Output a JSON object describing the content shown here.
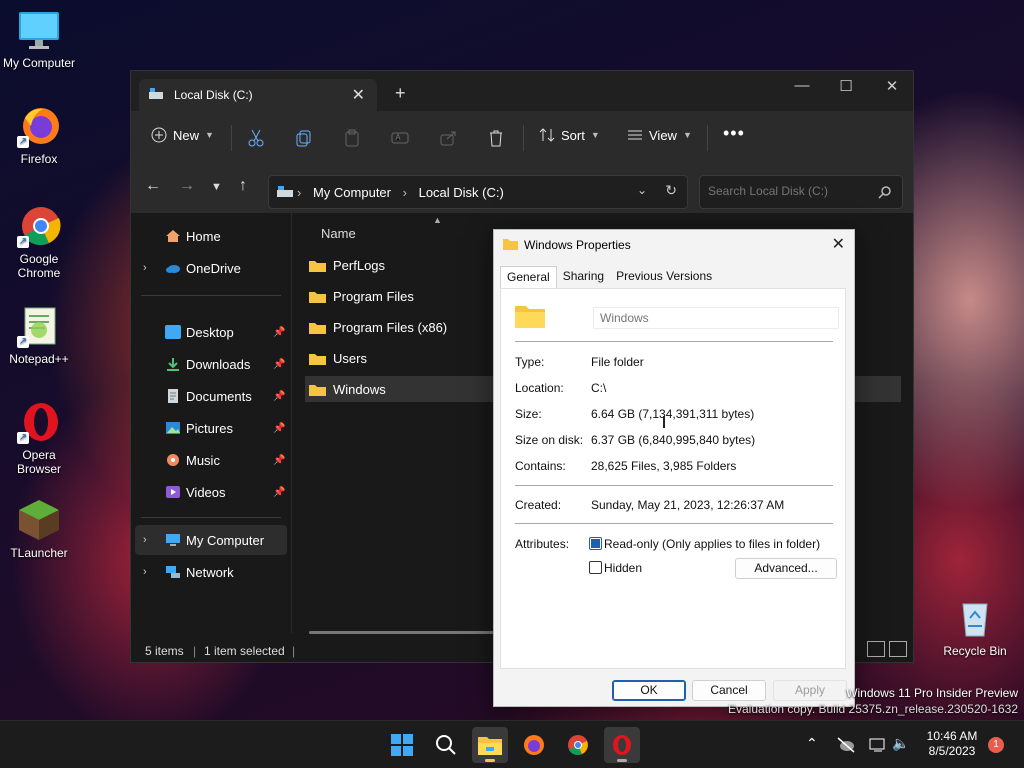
{
  "desktop": {
    "icons": [
      {
        "label": "My Computer"
      },
      {
        "label": "Firefox"
      },
      {
        "label": "Google Chrome"
      },
      {
        "label": "Notepad++"
      },
      {
        "label": "Opera Browser"
      },
      {
        "label": "TLauncher"
      },
      {
        "label": "Recycle Bin"
      }
    ],
    "watermark_line1": "Windows 11 Pro Insider Preview",
    "watermark_line2": "Evaluation copy. Build 25375.zn_release.230520-1632"
  },
  "explorer": {
    "tab_title": "Local Disk (C:)",
    "toolbar": {
      "new_label": "New",
      "sort_label": "Sort",
      "view_label": "View"
    },
    "breadcrumb": [
      "My Computer",
      "Local Disk (C:)"
    ],
    "search_placeholder": "Search Local Disk (C:)",
    "sidebar": {
      "home": "Home",
      "onedrive": "OneDrive",
      "desktop": "Desktop",
      "downloads": "Downloads",
      "documents": "Documents",
      "pictures": "Pictures",
      "music": "Music",
      "videos": "Videos",
      "my_computer": "My Computer",
      "network": "Network"
    },
    "column_name": "Name",
    "files": [
      "PerfLogs",
      "Program Files",
      "Program Files (x86)",
      "Users",
      "Windows"
    ],
    "status": {
      "items": "5 items",
      "selected": "1 item selected"
    }
  },
  "properties": {
    "title": "Windows Properties",
    "tabs": [
      "General",
      "Sharing",
      "Previous Versions"
    ],
    "name_value": "Windows",
    "rows": {
      "type_label": "Type:",
      "type_value": "File folder",
      "location_label": "Location:",
      "location_value": "C:\\",
      "size_label": "Size:",
      "size_value": "6.64 GB (7,134,391,311 bytes)",
      "size_on_disk_label": "Size on disk:",
      "size_on_disk_value": "6.37 GB (6,840,995,840 bytes)",
      "contains_label": "Contains:",
      "contains_value": "28,625 Files, 3,985 Folders",
      "created_label": "Created:",
      "created_value": "Sunday, May 21, 2023, 12:26:37 AM",
      "attributes_label": "Attributes:"
    },
    "readonly_label": "Read-only (Only applies to files in folder)",
    "hidden_label": "Hidden",
    "advanced_label": "Advanced...",
    "ok_label": "OK",
    "cancel_label": "Cancel",
    "apply_label": "Apply"
  },
  "taskbar": {
    "time": "10:46 AM",
    "date": "8/5/2023",
    "notification_count": "1"
  }
}
